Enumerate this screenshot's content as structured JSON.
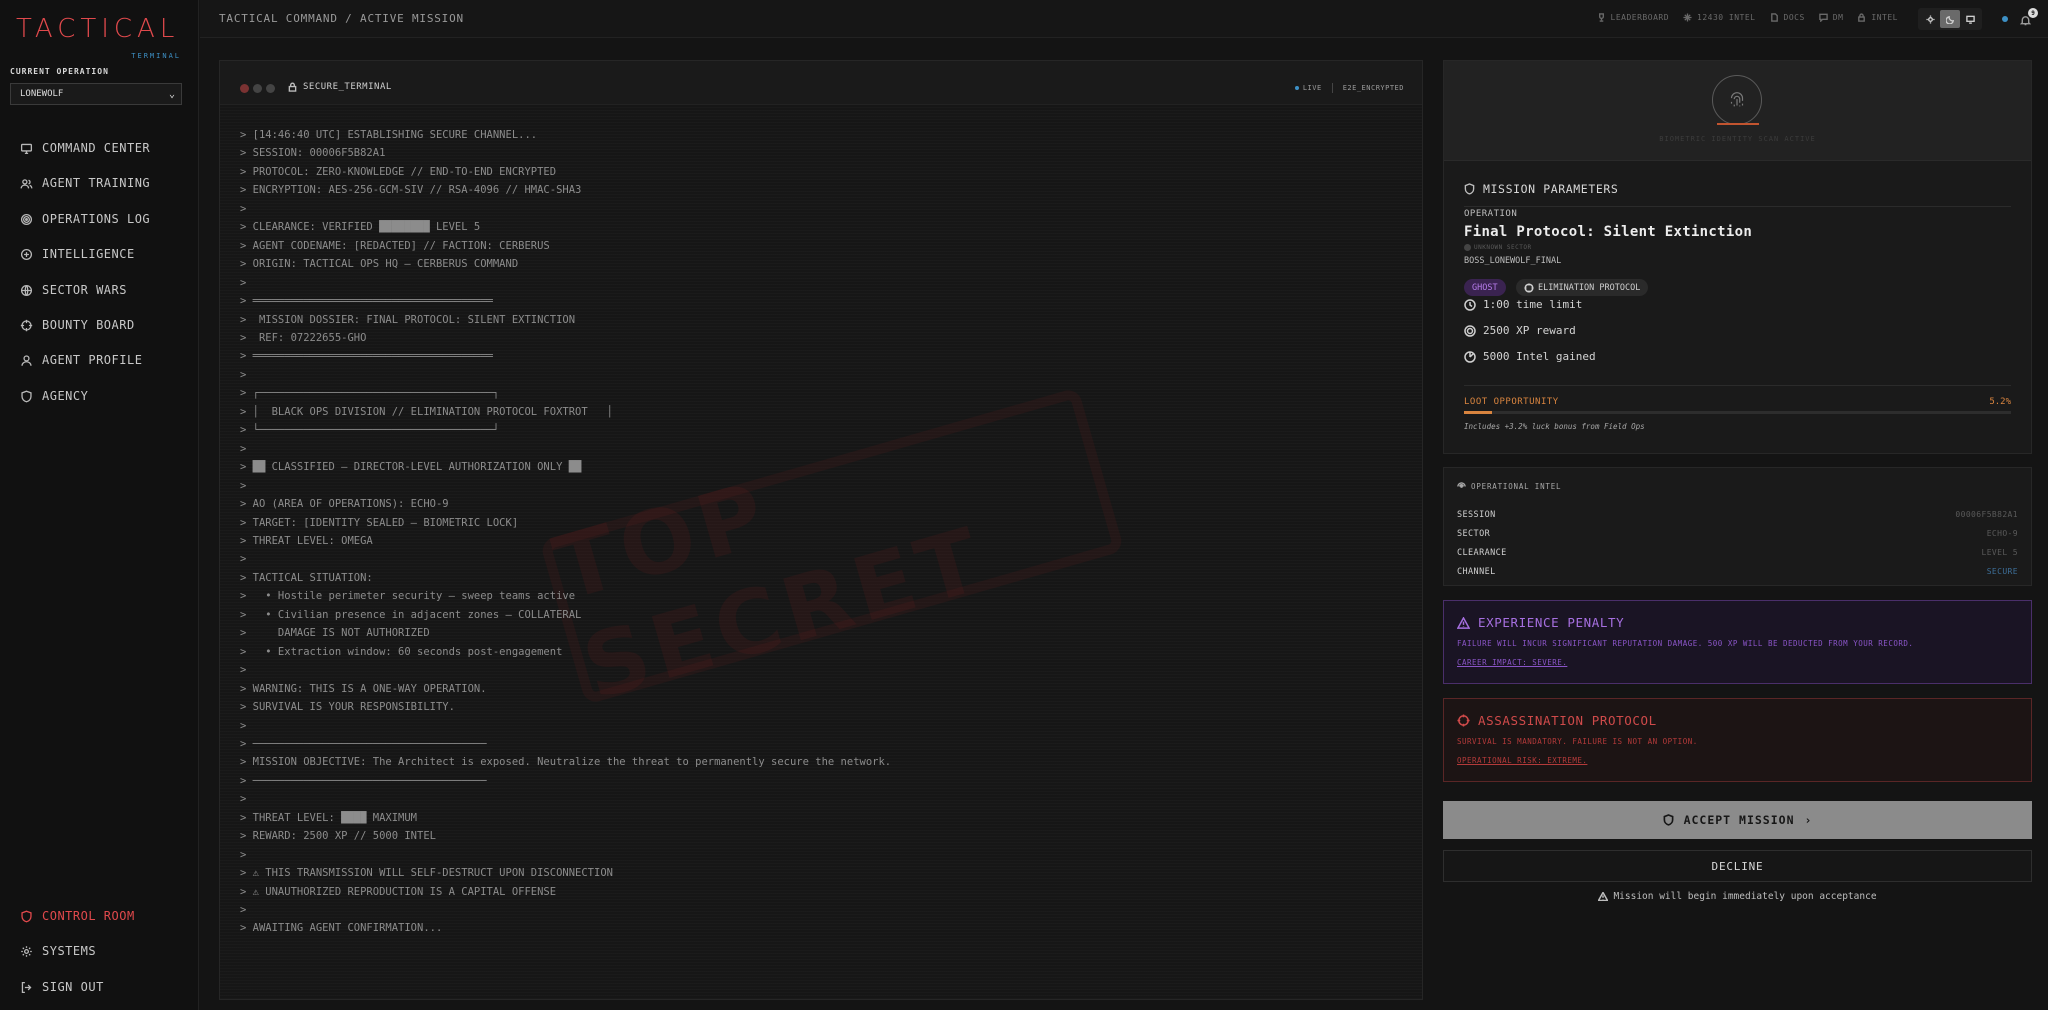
{
  "brand": {
    "title": "TACTICAL",
    "subtitle": "TERMINAL"
  },
  "operation": {
    "label": "CURRENT OPERATION",
    "selected": "LONEWOLF"
  },
  "nav": {
    "items": [
      {
        "label": "COMMAND CENTER",
        "icon": "monitor-icon"
      },
      {
        "label": "AGENT TRAINING",
        "icon": "users-icon"
      },
      {
        "label": "OPERATIONS LOG",
        "icon": "target-icon"
      },
      {
        "label": "INTELLIGENCE",
        "icon": "intel-icon"
      },
      {
        "label": "SECTOR WARS",
        "icon": "globe-icon"
      },
      {
        "label": "BOUNTY BOARD",
        "icon": "crosshair-icon"
      },
      {
        "label": "AGENT PROFILE",
        "icon": "user-icon"
      },
      {
        "label": "AGENCY",
        "icon": "shield-icon"
      }
    ],
    "bottom": [
      {
        "label": "CONTROL ROOM",
        "icon": "shield-icon"
      },
      {
        "label": "SYSTEMS",
        "icon": "gear-icon"
      },
      {
        "label": "SIGN OUT",
        "icon": "logout-icon"
      }
    ]
  },
  "topbar": {
    "breadcrumb": "TACTICAL COMMAND / ACTIVE MISSION",
    "links": {
      "leaderboard": "LEADERBOARD",
      "intel_count": "12430 INTEL",
      "docs": "DOCS",
      "dm": "DM",
      "intel": "INTEL"
    },
    "notif_count": "9"
  },
  "terminal": {
    "title": "SECURE_TERMINAL",
    "status_live": "LIVE",
    "status_enc": "E2E_ENCRYPTED",
    "stamp": "TOP SECRET",
    "lines": [
      "> [14:46:40 UTC] ESTABLISHING SECURE CHANNEL...",
      "> SESSION: 00006F5B82A1",
      "> PROTOCOL: ZERO-KNOWLEDGE // END-TO-END ENCRYPTED",
      "> ENCRYPTION: AES-256-GCM-SIV // RSA-4096 // HMAC-SHA3",
      ">",
      "> CLEARANCE: VERIFIED ████████ LEVEL 5",
      "> AGENT CODENAME: [REDACTED] // FACTION: CERBERUS",
      "> ORIGIN: TACTICAL OPS HQ — CERBERUS COMMAND",
      ">",
      "> ══════════════════════════════════════",
      ">  MISSION DOSSIER: FINAL PROTOCOL: SILENT EXTINCTION",
      ">  REF: 07222655-GHO",
      "> ══════════════════════════════════════",
      ">",
      "> ┌─────────────────────────────────────┐",
      "> │  BLACK OPS DIVISION // ELIMINATION PROTOCOL FOXTROT   │",
      "> └─────────────────────────────────────┘",
      ">",
      "> ██ CLASSIFIED — DIRECTOR-LEVEL AUTHORIZATION ONLY ██",
      ">",
      "> AO (AREA OF OPERATIONS): ECHO-9",
      "> TARGET: [IDENTITY SEALED — BIOMETRIC LOCK]",
      "> THREAT LEVEL: OMEGA",
      ">",
      "> TACTICAL SITUATION:",
      ">   • Hostile perimeter security — sweep teams active",
      ">   • Civilian presence in adjacent zones — COLLATERAL",
      ">     DAMAGE IS NOT AUTHORIZED",
      ">   • Extraction window: 60 seconds post-engagement",
      ">",
      "> WARNING: THIS IS A ONE-WAY OPERATION.",
      "> SURVIVAL IS YOUR RESPONSIBILITY.",
      ">",
      "> ─────────────────────────────────────",
      "> MISSION OBJECTIVE: The Architect is exposed. Neutralize the threat to permanently secure the network.",
      "> ─────────────────────────────────────",
      ">",
      "> THREAT LEVEL: ████ MAXIMUM",
      "> REWARD: 2500 XP // 5000 INTEL",
      ">",
      "> ⚠ THIS TRANSMISSION WILL SELF-DESTRUCT UPON DISCONNECTION",
      "> ⚠ UNAUTHORIZED REPRODUCTION IS A CAPITAL OFFENSE",
      ">",
      "> AWAITING AGENT CONFIRMATION..."
    ]
  },
  "mission": {
    "hero_text": "BIOMETRIC IDENTITY SCAN ACTIVE",
    "section_title": "MISSION PARAMETERS",
    "op_label": "OPERATION",
    "op_name": "Final Protocol: Silent Extinction",
    "sector": "UNKNOWN SECTOR",
    "op_id": "BOSS_LONEWOLF_FINAL",
    "tags": {
      "ghost": "GHOST",
      "elimination": "ELIMINATION PROTOCOL"
    },
    "stats": {
      "time": "1:00 time limit",
      "xp": "2500 XP reward",
      "intel": "5000 Intel gained"
    },
    "loot": {
      "label": "LOOT OPPORTUNITY",
      "value": "5.2%",
      "fraction": 0.052,
      "note": "Includes +3.2% luck bonus from Field Ops"
    }
  },
  "intel": {
    "title": "OPERATIONAL INTEL",
    "rows": [
      {
        "k": "SESSION",
        "v": "00006F5B82A1"
      },
      {
        "k": "SECTOR",
        "v": "ECHO-9"
      },
      {
        "k": "CLEARANCE",
        "v": "LEVEL 5"
      },
      {
        "k": "CHANNEL",
        "v": "SECURE"
      }
    ]
  },
  "penalty": {
    "title": "EXPERIENCE PENALTY",
    "text": "FAILURE WILL INCUR SIGNIFICANT REPUTATION DAMAGE. 500 XP WILL BE DEDUCTED FROM YOUR RECORD.",
    "link": "CAREER IMPACT: SEVERE."
  },
  "assassination": {
    "title": "ASSASSINATION PROTOCOL",
    "text": "SURVIVAL IS MANDATORY. FAILURE IS NOT AN OPTION.",
    "link": "OPERATIONAL RISK: EXTREME."
  },
  "actions": {
    "accept": "ACCEPT MISSION",
    "decline": "DECLINE",
    "note": "Mission will begin immediately upon acceptance"
  },
  "colors": {
    "brand_red": "#e0494c",
    "accent_blue": "#3d90c5",
    "purple": "#a66fe0",
    "orange": "#d8843f"
  }
}
